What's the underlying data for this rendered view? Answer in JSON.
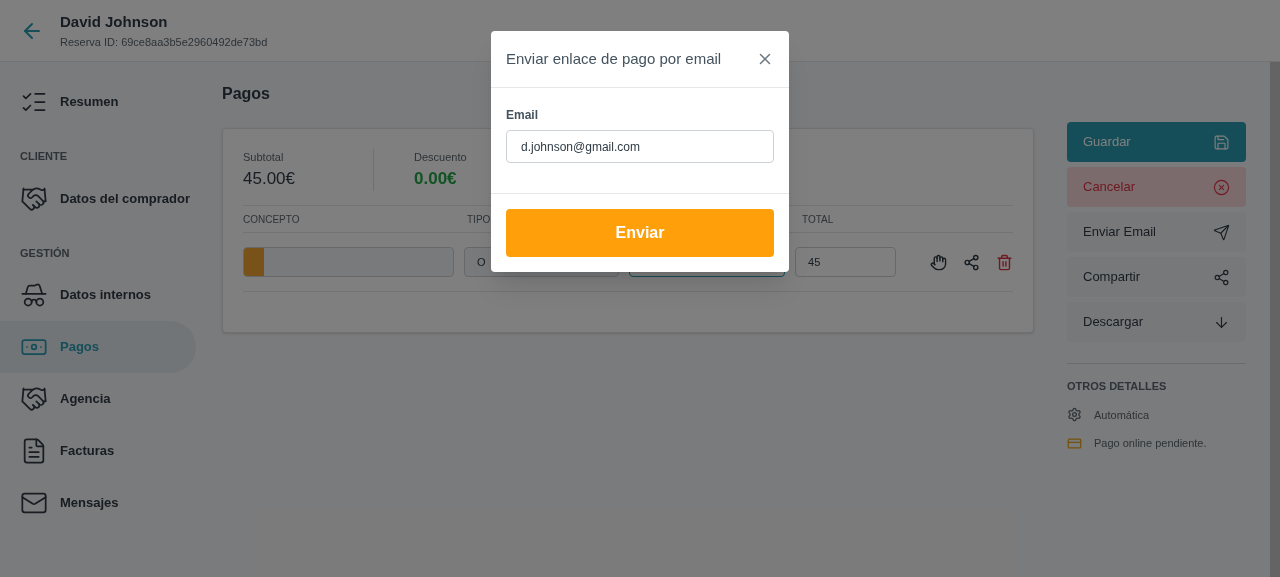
{
  "header": {
    "title": "David Johnson",
    "subtitle": "Reserva ID: 69ce8aa3b5e2960492de73bd"
  },
  "sidebar": {
    "items": [
      {
        "kind": "item",
        "label": "Resumen",
        "selected": false
      },
      {
        "kind": "section",
        "label": "CLIENTE"
      },
      {
        "kind": "item",
        "label": "Datos del comprador",
        "selected": false
      },
      {
        "kind": "section",
        "label": "GESTIÓN"
      },
      {
        "kind": "item",
        "label": "Datos internos",
        "selected": false
      },
      {
        "kind": "item",
        "label": "Pagos",
        "selected": true
      },
      {
        "kind": "item",
        "label": "Agencia",
        "selected": false
      },
      {
        "kind": "item",
        "label": "Facturas",
        "selected": false
      },
      {
        "kind": "item",
        "label": "Mensajes",
        "selected": false
      }
    ]
  },
  "page_title": "Pagos",
  "summary": [
    {
      "label": "Subtotal",
      "value": "45.00€",
      "kind": "plain"
    },
    {
      "label": "Descuento",
      "value": "0.00€",
      "kind": "positive"
    }
  ],
  "table": {
    "columns": [
      "CONCEPTO",
      "TIPO",
      "TOTAL"
    ],
    "row": {
      "tipo": "O",
      "total": "45"
    }
  },
  "actions": [
    {
      "label": "Guardar",
      "kind": "primary"
    },
    {
      "label": "Cancelar",
      "kind": "danger"
    },
    {
      "label": "Enviar Email",
      "kind": "default"
    },
    {
      "label": "Compartir",
      "kind": "default"
    },
    {
      "label": "Descargar",
      "kind": "default"
    }
  ],
  "details": {
    "title": "OTROS DETALLES",
    "items": [
      {
        "text": "Automática"
      },
      {
        "text": "Pago online pendiente."
      }
    ]
  },
  "modal": {
    "title": "Enviar enlace de pago por email",
    "field_label": "Email",
    "value": "d.johnson@gmail.com",
    "button": "Enviar"
  }
}
